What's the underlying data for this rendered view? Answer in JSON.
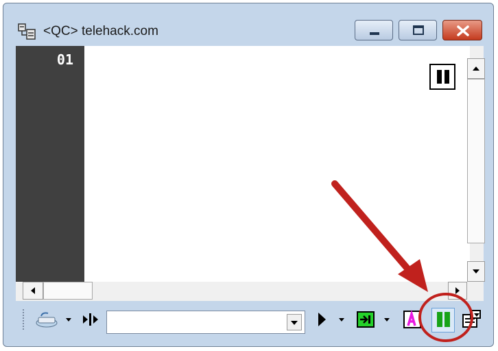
{
  "window": {
    "title": "<QC> telehack.com",
    "controls": {
      "minimize_icon": "minimize-icon",
      "maximize_icon": "maximize-icon",
      "close_icon": "close-icon"
    }
  },
  "editor": {
    "line_number": "01",
    "pause_indicator_icon": "pause-icon"
  },
  "scrollbars": {
    "vertical": {
      "up_icon": "arrow-up-icon",
      "down_icon": "arrow-down-icon"
    },
    "horizontal": {
      "left_icon": "arrow-left-icon",
      "right_icon": "arrow-right-icon"
    }
  },
  "toolbar": {
    "items": [
      {
        "icon": "keyboard-icon"
      },
      {
        "icon": "split-arrows-icon"
      },
      {
        "icon": "play-icon"
      },
      {
        "icon": "step-into-icon"
      },
      {
        "icon": "highlight-text-icon"
      },
      {
        "icon": "pause-icon",
        "highlighted": true
      },
      {
        "icon": "properties-icon"
      }
    ],
    "command_input": {
      "value": "",
      "placeholder": ""
    }
  },
  "annotation": {
    "arrow_color": "#c0211d",
    "circle_color": "#c0211d"
  },
  "colors": {
    "gutter": "#404040",
    "window_frame": "#c4d6ea",
    "pause_green": "#17a317",
    "close_red": "#c43a1e"
  }
}
